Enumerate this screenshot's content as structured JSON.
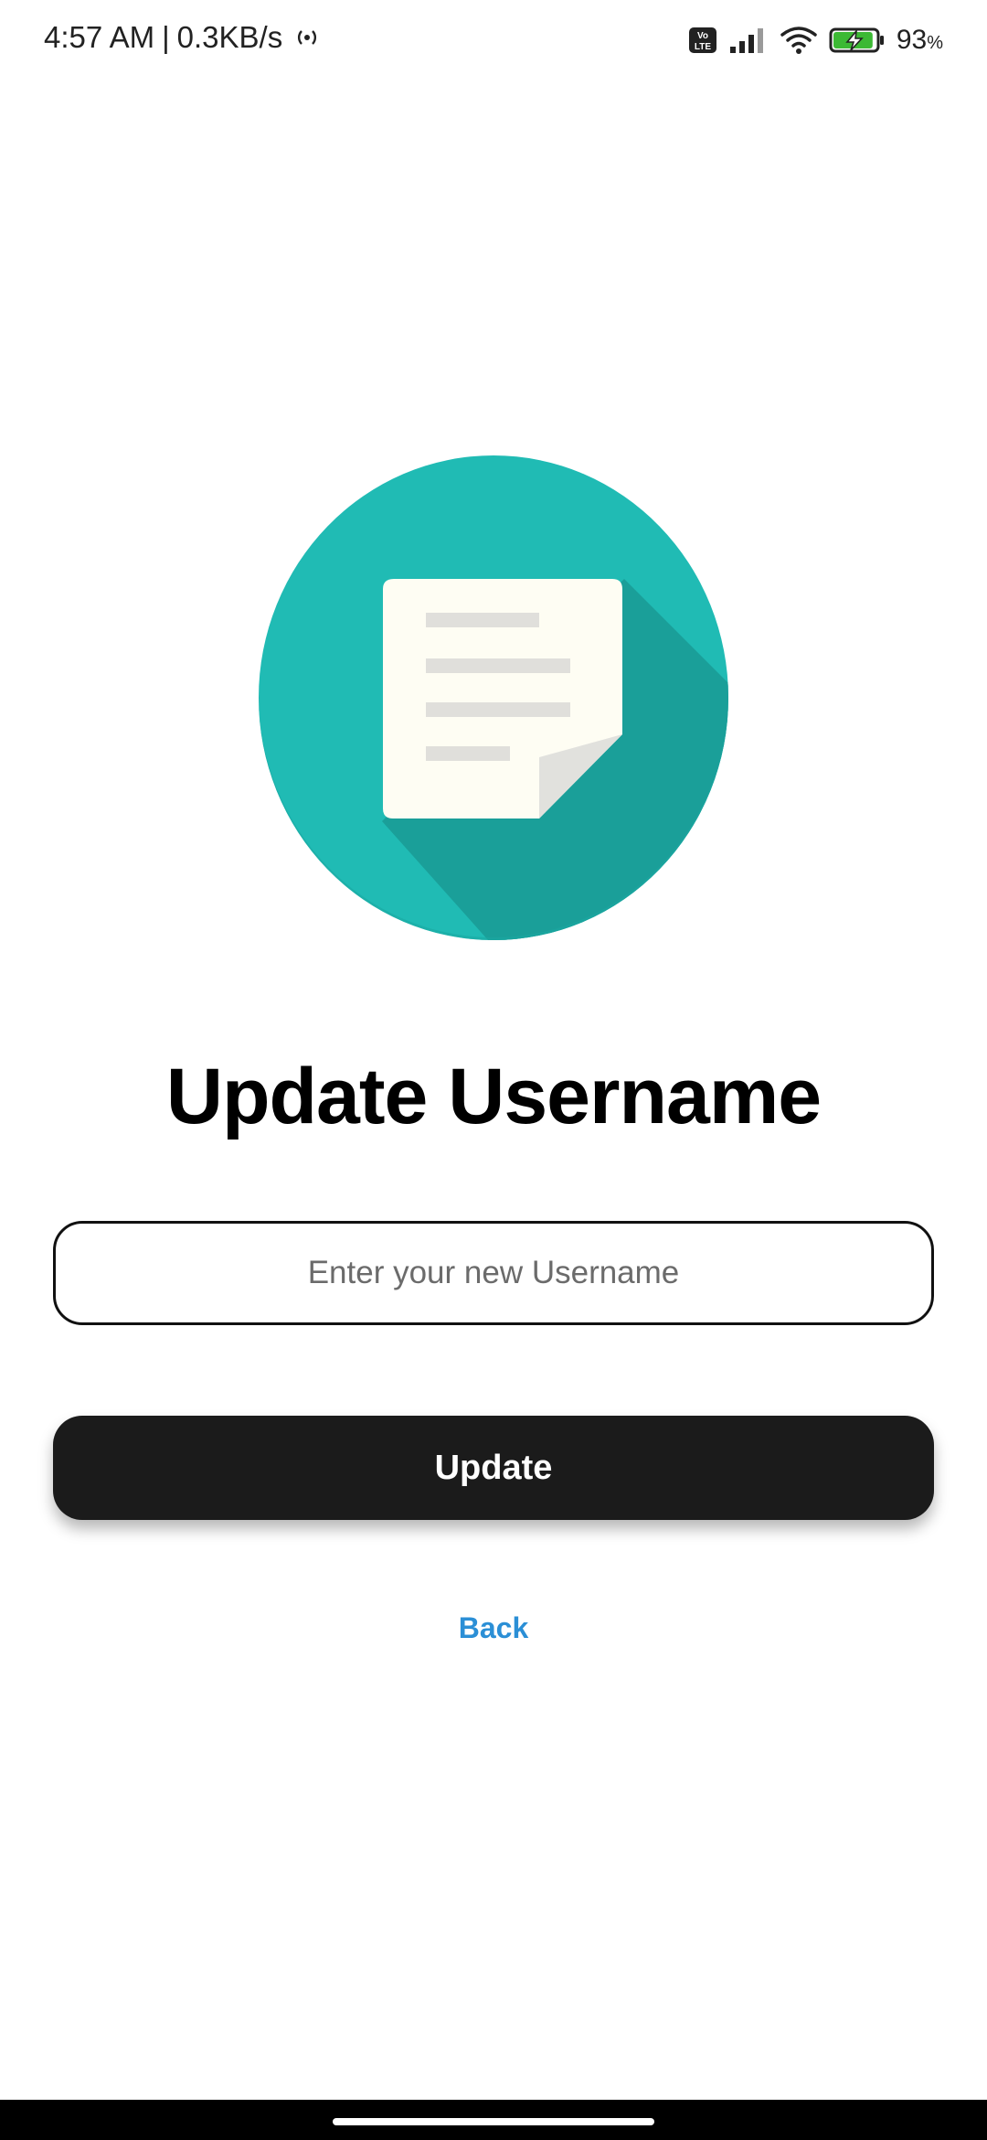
{
  "status_bar": {
    "time": "4:57 AM",
    "separator": "|",
    "net_speed": "0.3KB/s",
    "battery_percent": "93",
    "battery_symbol": "%",
    "icons": [
      "hotspot-icon",
      "volte-icon",
      "signal-icon",
      "wifi-icon",
      "battery-charging-icon"
    ],
    "battery_level": 0.93
  },
  "hero": {
    "icon": "notes-icon",
    "colors": {
      "circle": "#20bbb4",
      "shadow": "#1a9f99",
      "paper": "#fefdf3",
      "fold": "#e1e1dd",
      "lines": "#e0dfdb"
    }
  },
  "title": "Update Username",
  "username_input": {
    "value": "",
    "placeholder": "Enter your new Username"
  },
  "update_button": {
    "label": "Update"
  },
  "back_link": {
    "label": "Back",
    "color": "#2b8fd6"
  }
}
